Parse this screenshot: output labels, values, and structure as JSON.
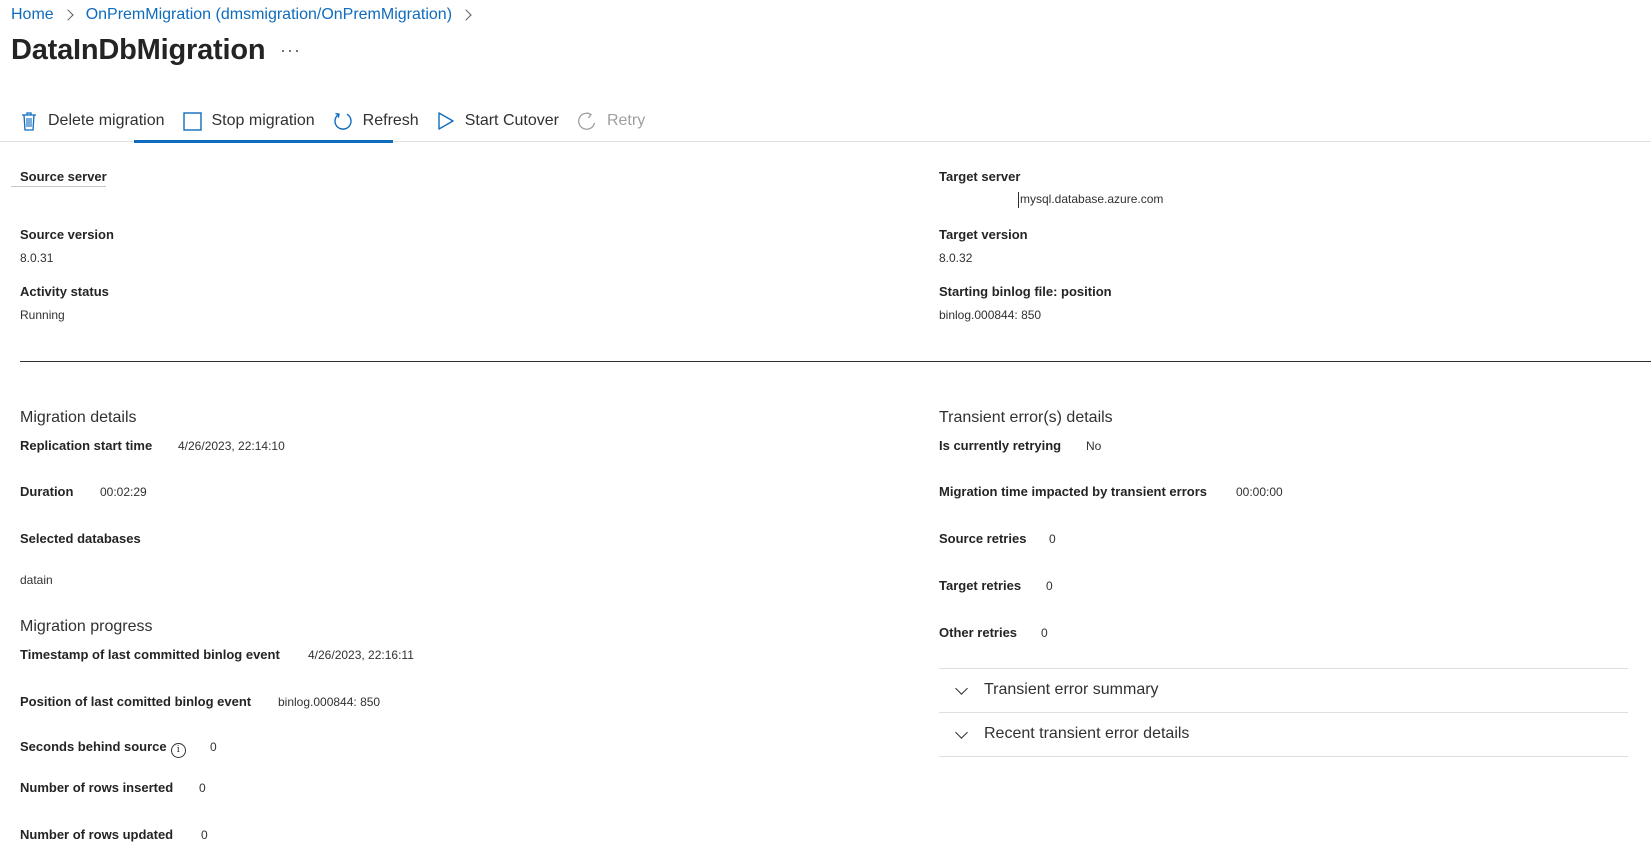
{
  "breadcrumb": {
    "home": "Home",
    "item1": "OnPremMigration (dmsmigration/OnPremMigration)"
  },
  "page": {
    "title": "DataInDbMigration",
    "more": "···"
  },
  "toolbar": {
    "delete": "Delete migration",
    "stop": "Stop migration",
    "refresh": "Refresh",
    "cutover": "Start Cutover",
    "retry": "Retry",
    "accent": "#0f6cbd"
  },
  "summary": {
    "source_server_label": "Source server",
    "source_server_value": "",
    "target_server_label": "Target server",
    "target_server_value": "mysql.database.azure.com",
    "source_version_label": "Source version",
    "source_version_value": "8.0.31",
    "target_version_label": "Target version",
    "target_version_value": "8.0.32",
    "activity_status_label": "Activity status",
    "activity_status_value": "Running",
    "binlog_label": "Starting binlog file: position",
    "binlog_value": "binlog.000844: 850"
  },
  "migration_details": {
    "title": "Migration details",
    "replication_start_label": "Replication start time",
    "replication_start_value": "4/26/2023, 22:14:10",
    "duration_label": "Duration",
    "duration_value": "00:02:29",
    "selected_db_label": "Selected databases",
    "selected_db_value": "datain"
  },
  "migration_progress": {
    "title": "Migration progress",
    "timestamp_label": "Timestamp of last committed binlog event",
    "timestamp_value": "4/26/2023, 22:16:11",
    "position_label": "Position of last comitted binlog event",
    "position_value": "binlog.000844: 850",
    "seconds_behind_label": "Seconds behind source",
    "seconds_behind_value": "0",
    "rows_inserted_label": "Number of rows inserted",
    "rows_inserted_value": "0",
    "rows_updated_label": "Number of rows updated",
    "rows_updated_value": "0"
  },
  "transient": {
    "title": "Transient error(s) details",
    "retrying_label": "Is currently retrying",
    "retrying_value": "No",
    "impacted_label": "Migration time impacted by transient errors",
    "impacted_value": "00:00:00",
    "source_retries_label": "Source retries",
    "source_retries_value": "0",
    "target_retries_label": "Target retries",
    "target_retries_value": "0",
    "other_retries_label": "Other retries",
    "other_retries_value": "0",
    "summary_accordion": "Transient error summary",
    "recent_accordion": "Recent transient error details"
  }
}
